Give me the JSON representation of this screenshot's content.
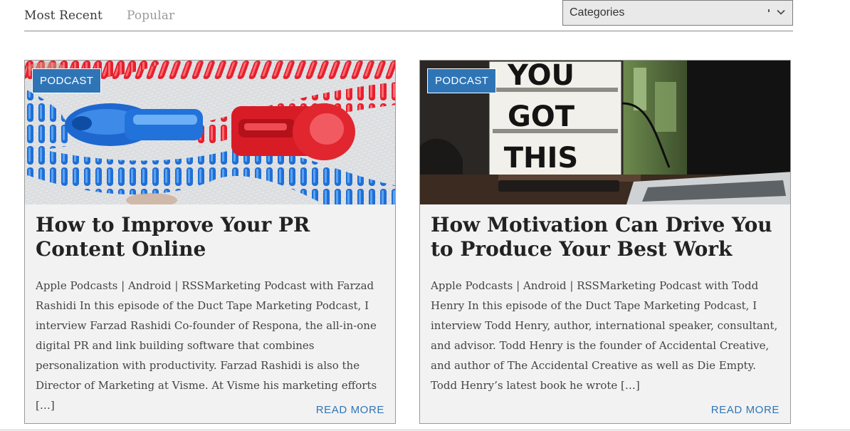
{
  "filters": {
    "tabs": [
      {
        "label": "Most Recent",
        "active": true
      },
      {
        "label": "Popular",
        "active": false
      }
    ],
    "categories_select": {
      "selected": "Categories",
      "icon": "chevron-down-icon"
    }
  },
  "posts": [
    {
      "category": "PODCAST",
      "image_subject": "zipper-image",
      "title": "How to Improve Your PR Content Online",
      "excerpt": "Apple Podcasts | Android | RSSMarketing Podcast with Farzad Rashidi In this episode of the Duct Tape Marketing Podcast, I interview Farzad Rashidi Co-founder of Respona, the all-in-one digital PR and link building software that combines personalization with productivity. Farzad Rashidi is also the Director of Marketing at Visme. At Visme his marketing efforts […]",
      "read_more": "READ MORE"
    },
    {
      "category": "PODCAST",
      "image_subject": "lightbox-sign-image",
      "image_text": [
        "YOU",
        "GOT",
        "THIS"
      ],
      "title": "How Motivation Can Drive You to Produce Your Best Work",
      "excerpt": "Apple Podcasts | Android | RSSMarketing Podcast with Todd Henry In this episode of the Duct Tape Marketing Podcast, I interview Todd Henry, author, international speaker, consultant, and advisor. Todd Henry is the founder of Accidental Creative, and author of The Accidental Creative as well as Die Empty. Todd Henry’s latest book he wrote […]",
      "read_more": "READ MORE"
    }
  ],
  "colors": {
    "accent": "#2f75b6",
    "card_background": "#f2f2f2",
    "title_text": "#222222",
    "body_text": "#444444"
  }
}
